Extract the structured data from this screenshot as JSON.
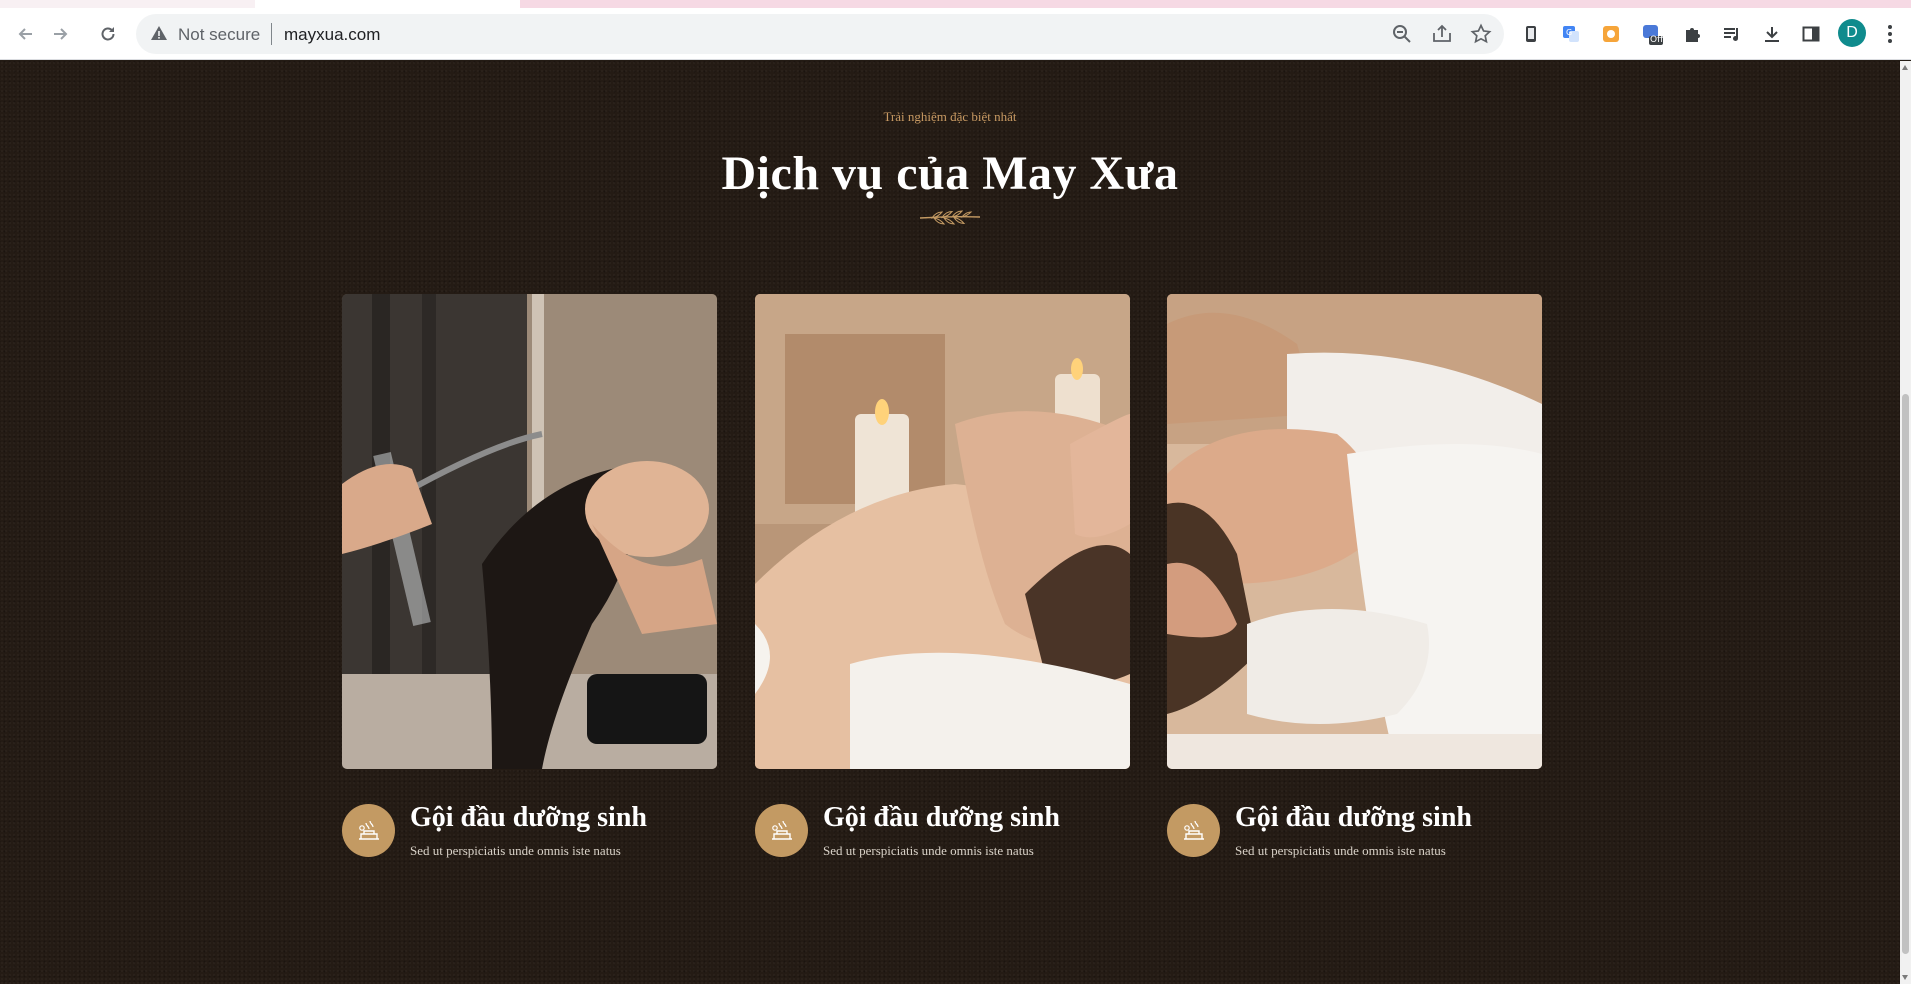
{
  "browser": {
    "security_label": "Not secure",
    "url": "mayxua.com",
    "profile_initial": "D",
    "extension_badge": "Off"
  },
  "section": {
    "eyebrow": "Trải nghiệm đặc biệt nhất",
    "title": "Dịch vụ của May Xưa"
  },
  "services": [
    {
      "title": "Gội đầu dưỡng sinh",
      "description": "Sed ut perspiciatis unde omnis iste natus",
      "icon": "spa-icon"
    },
    {
      "title": "Gội đầu dưỡng sinh",
      "description": "Sed ut perspiciatis unde omnis iste natus",
      "icon": "spa-icon"
    },
    {
      "title": "Gội đầu dưỡng sinh",
      "description": "Sed ut perspiciatis unde omnis iste natus",
      "icon": "spa-icon"
    }
  ],
  "colors": {
    "background": "#231b14",
    "accent": "#c39a63",
    "heading": "#ffffff"
  }
}
